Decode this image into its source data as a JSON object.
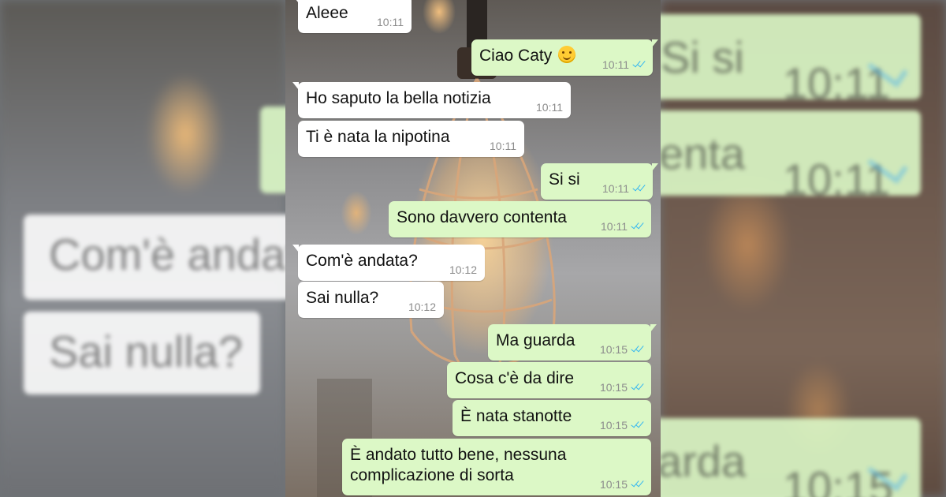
{
  "messages": [
    {
      "dir": "in",
      "text": "Aleee",
      "time": "10:11"
    },
    {
      "dir": "out",
      "text": "Ciao Caty",
      "emoji": "smiling-face-emoji",
      "time": "10:11"
    },
    {
      "dir": "in",
      "text": "Ho saputo la bella notizia",
      "time": "10:11"
    },
    {
      "dir": "in",
      "text": "Ti è nata la nipotina",
      "time": "10:11"
    },
    {
      "dir": "out",
      "text": "Si si",
      "time": "10:11"
    },
    {
      "dir": "out",
      "text": "Sono davvero contenta",
      "time": "10:11"
    },
    {
      "dir": "in",
      "text": "Com'è andata?",
      "time": "10:12"
    },
    {
      "dir": "in",
      "text": "Sai nulla?",
      "time": "10:12"
    },
    {
      "dir": "out",
      "text": "Ma guarda",
      "time": "10:15"
    },
    {
      "dir": "out",
      "text": "Cosa c'è da dire",
      "time": "10:15"
    },
    {
      "dir": "out",
      "text": "È nata stanotte",
      "time": "10:15"
    },
    {
      "dir": "out",
      "text": "È andato tutto bene, nessuna complicazione di sorta",
      "time": "10:15"
    }
  ],
  "blurred_left": {
    "line1": "Com'è andata",
    "line2": "Sai nulla?"
  },
  "blurred_right": {
    "line1": "Si si",
    "line2": "enta",
    "line3": "arda",
    "time1": "10:11",
    "time2": "10:11",
    "time3": "10:15"
  },
  "colors": {
    "outgoing_bubble": "#dcf8c6",
    "incoming_bubble": "#ffffff",
    "read_ticks": "#34b7f1"
  },
  "status_icon": "double-check-icon"
}
